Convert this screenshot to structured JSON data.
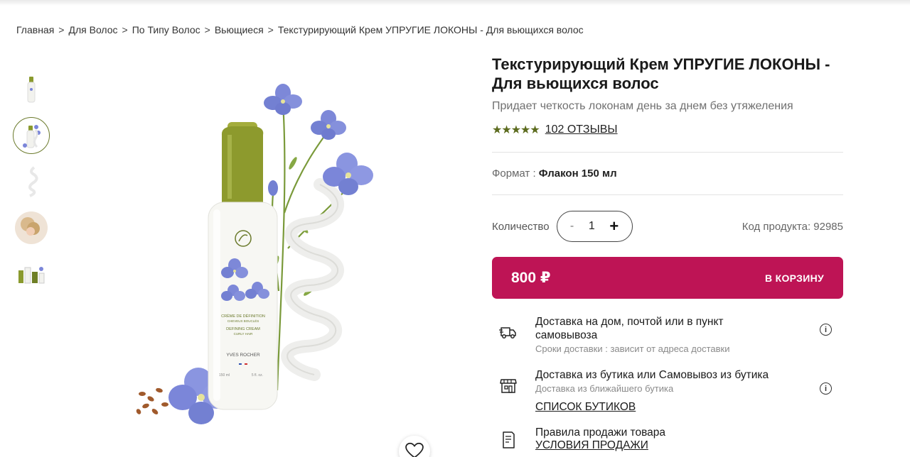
{
  "breadcrumb": [
    "Главная",
    "Для Волос",
    "По Типу Волос",
    "Вьющиеся",
    "Текстурирующий Крем УПРУГИЕ ЛОКОНЫ - Для вьющихся волос"
  ],
  "breadcrumb_separator": ">",
  "product": {
    "title": "Текстурирующий Крем УПРУГИЕ ЛОКОНЫ - Для вьющихся волос",
    "subtitle": "Придает четкость локонам день за днем без утяжеления",
    "stars_text": "★★★★★",
    "rating": 5,
    "reviews": "102 ОТЗЫВЫ",
    "format_label": "Формат :",
    "format_value": "Флакон 150 мл",
    "quantity_label": "Количество",
    "quantity": "1",
    "minus": "-",
    "plus": "+",
    "code": "Код продукта: 92985",
    "price": "800 ₽",
    "cart_label": "В КОРЗИНУ",
    "bottle_text": {
      "line1": "CRÈME DE DÉFINITION",
      "line2": "CHEVEUX BOUCLÉS",
      "line3": "DEFINING CREAM",
      "line4": "CURLY HAIR",
      "brand": "YVES ROCHER",
      "volume_ml": "150 ml",
      "volume_oz": "5 fl. oz."
    }
  },
  "delivery": [
    {
      "title": "Доставка на дом, почтой или в пункт самовывоза",
      "sub": "Сроки доставки : зависит от адреса доставки",
      "icon": "truck-icon"
    },
    {
      "title": "Доставка из бутика или Самовывоз из бутика",
      "sub": "Доставка из ближайшего бутика",
      "link": "СПИСОК БУТИКОВ",
      "icon": "store-icon"
    },
    {
      "title": "Правила продажи товара",
      "link": "УСЛОВИЯ ПРОДАЖИ",
      "icon": "document-icon"
    }
  ],
  "colors": {
    "accent": "#be1455",
    "olive": "#5c6b1e",
    "flower": "#7b86d9"
  }
}
